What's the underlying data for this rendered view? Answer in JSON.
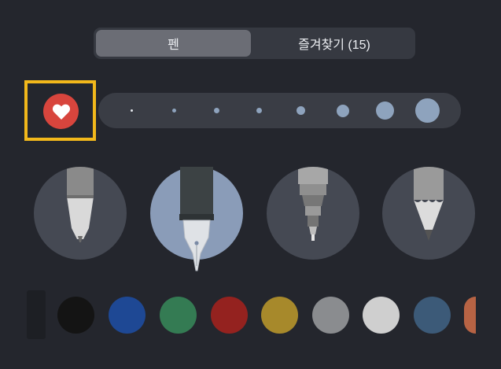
{
  "segmented": {
    "pen_label": "펜",
    "favorites_label": "즐겨찾기 (15)"
  },
  "favorite_button": {
    "icon": "heart-icon",
    "color": "#d8453d",
    "highlight_color": "#f2b81b"
  },
  "size_picker": {
    "options": [
      "size-1",
      "size-2",
      "size-3",
      "size-4",
      "size-5",
      "size-6",
      "size-7",
      "size-8"
    ],
    "selected": "size-8",
    "dot_color": "#8ea3bd"
  },
  "tools": [
    {
      "name": "ballpoint-pen-icon",
      "selected": false
    },
    {
      "name": "fountain-pen-icon",
      "selected": true
    },
    {
      "name": "fineliner-icon",
      "selected": false
    },
    {
      "name": "pencil-icon",
      "selected": false
    }
  ],
  "colors": [
    "#141414",
    "#1e4894",
    "#347b53",
    "#94221f",
    "#a7892b",
    "#8a8c8f",
    "#cfcfcf",
    "#3c5a78",
    "#b76344"
  ]
}
